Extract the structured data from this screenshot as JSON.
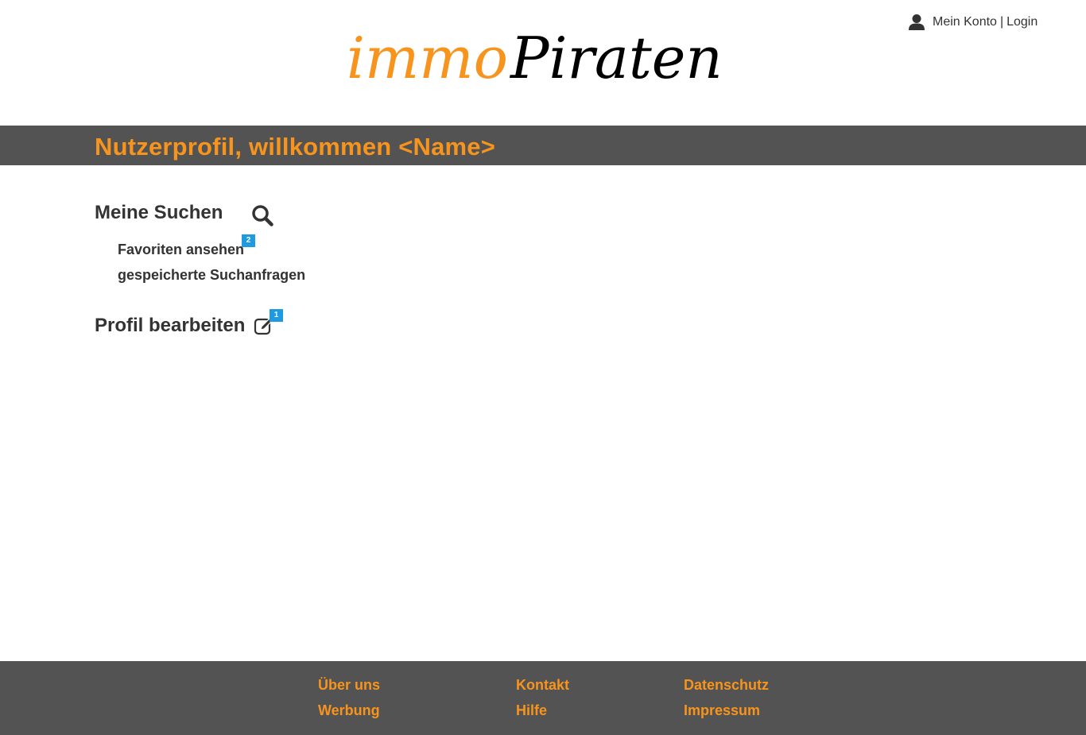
{
  "header": {
    "logo_part1": "immo",
    "logo_part2": "Piraten",
    "account_label": "Mein Konto",
    "separator": "|",
    "login_label": "Login"
  },
  "title_bar": {
    "title": "Nutzerprofil, willkommen <Name>"
  },
  "searches": {
    "heading": "Meine Suchen",
    "icon": "search-icon",
    "favorites_label": "Favoriten ansehen",
    "favorites_badge": "2",
    "saved_searches_label": "gespeicherte Suchanfragen"
  },
  "profile": {
    "heading": "Profil bearbeiten",
    "icon": "edit-icon",
    "badge": "1"
  },
  "footer": {
    "col1": [
      "Über uns",
      "Werbung"
    ],
    "col2": [
      "Kontakt",
      "Hilfe"
    ],
    "col3": [
      "Datenschutz",
      "Impressum"
    ]
  },
  "colors": {
    "accent": "#f7941d",
    "bar": "#535353",
    "badge": "#1e9be0",
    "text": "#333333"
  }
}
